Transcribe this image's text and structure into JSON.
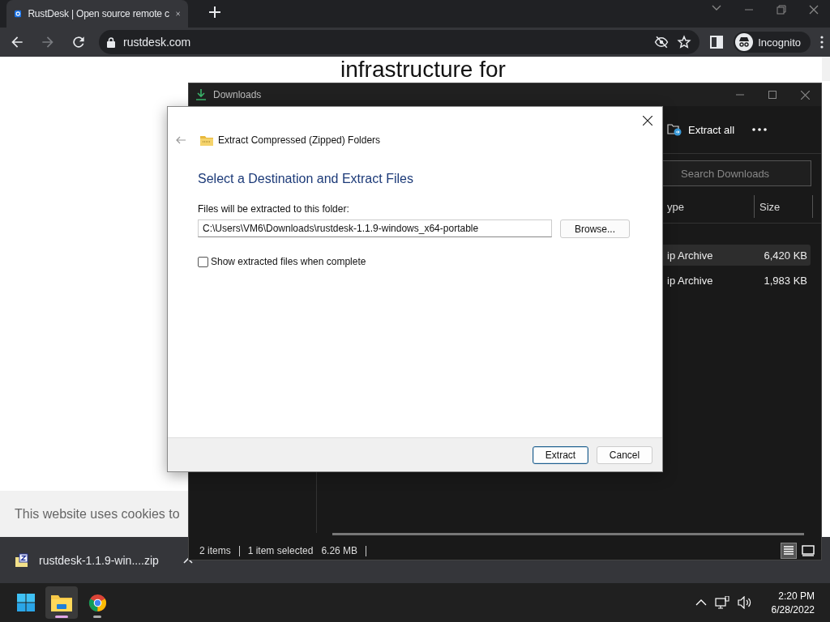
{
  "browser": {
    "tabs": [
      {
        "title": "RustDesk | Open source remote c",
        "selected": true
      }
    ],
    "nav": [
      {
        "kind": "back",
        "disabled": false
      },
      {
        "kind": "forward",
        "disabled": true
      },
      {
        "kind": "reload",
        "disabled": false
      }
    ],
    "address": "rustdesk.com",
    "profile": "Incognito"
  },
  "page": {
    "headline": "infrastructure for",
    "cookie_notice": "This website uses cookies to"
  },
  "download_bar": {
    "file": "rustdesk-1.1.9-win....zip"
  },
  "explorer": {
    "title": "Downloads",
    "toolbar": [
      "Extract all"
    ],
    "search": {
      "placeholder": "Search Downloads"
    },
    "columns": [
      "ype",
      "Size"
    ],
    "rows": [
      {
        "type": "ip Archive",
        "size": "6,420 KB",
        "selected": true
      },
      {
        "type": "ip Archive",
        "size": "1,983 KB",
        "selected": false
      }
    ],
    "status": [
      "2 items",
      "1 item selected",
      "6.26 MB"
    ],
    "view": [
      {
        "kind": "details",
        "selected": true
      },
      {
        "kind": "tiles",
        "selected": false
      }
    ]
  },
  "dialog": {
    "title": "Extract Compressed (Zipped) Folders",
    "heading": "Select a Destination and Extract Files",
    "label": "Files will be extracted to this folder:",
    "path": "C:\\Users\\VM6\\Downloads\\rustdesk-1.1.9-windows_x64-portable",
    "browse": "Browse...",
    "show_files": {
      "label": "Show extracted files when complete",
      "checked": false
    },
    "buttons": [
      {
        "label": "Extract",
        "default": true
      },
      {
        "label": "Cancel",
        "default": false
      }
    ]
  },
  "taskbar": {
    "apps": [
      {
        "kind": "start",
        "active": false
      },
      {
        "kind": "explorer",
        "active": true
      },
      {
        "kind": "chrome",
        "active": false
      }
    ],
    "time": "2:20 PM",
    "date": "6/28/2022"
  }
}
